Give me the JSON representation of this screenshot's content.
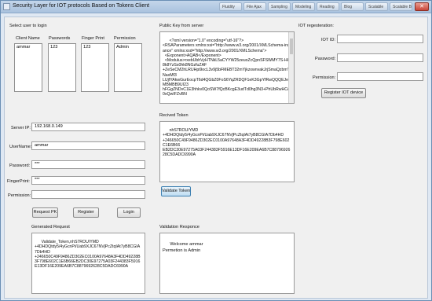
{
  "window": {
    "title": "Security Layer for IOT protocols Based on Tokens Client",
    "close_label": "✕",
    "tasks": [
      "Fluidity",
      "File Ajax",
      "Sampling",
      "Modeling",
      "Reading",
      "Blog",
      "Scalable",
      "Scalable Bg"
    ]
  },
  "select_user": {
    "heading": "Select user to login",
    "columns": [
      "Client Name",
      "Passwords",
      "Finger Print",
      "Permission"
    ],
    "values": [
      "ammar",
      "123",
      "123",
      "Admin"
    ]
  },
  "public_key": {
    "label": "Public Key from server",
    "content": "<?xml version=\"1.0\" encoding=\"utf-16\"?>\n<RSAParameters xmlns:xsi=\"http://www.w3.org/2001/XMLSchema-instance\" xmlns:xsd=\"http://www.w3.org/2001/XMLSchema\">\n  <Exponent>AQAB</Exponent>\n  <Modulus>rxebUbhVyHTNkL5aCYYW25zeuoZcQpnSFSWMY7S-Hk8k8YzSs0hk8NGzfuZAF\n+ZeSeCM2hLRUHpi9ocL3v9j5bFMEBT32mYjkzxwnvakJrjSmaQzbmYNaxMf3\nLUjfYAkwGurEocpT6d4QGbZ0FoS6YqZRDQF1eK3GpYfRwQQQEJewMBMBB9UI23\nhFGgZNDvC1E3hhkv0QoSW7fQcBKcgE3udTd0hg3N3+PhUbRwHCe0xQwIFZvBN"
  },
  "iot_register": {
    "heading": "IOT regesteration:",
    "id_label": "IOT ID:",
    "password_label": "Password:",
    "permission_label": "Permission:",
    "id_value": "",
    "password_value": "",
    "permission_value": "",
    "register_button": "Register IOT device"
  },
  "login_form": {
    "server_ip_label": "Server IP:",
    "server_ip_value": "192.168.0.149",
    "username_label": "UserName:",
    "username_value": "ammar",
    "password_label": "Password:",
    "password_value": "***",
    "fingerprint_label": "FingerPrint:",
    "fingerprint_value": "***",
    "permission_label": "Permission:",
    "permission_value": "",
    "request_pk_button": "Request PK",
    "register_button": "Register",
    "login_button": "Login"
  },
  "received_token": {
    "label": "Recived Token",
    "content": "nhS7ROU/YMD\n+4DHDQtdy5/4yGcnPi/Uab9XJC67NVjPcZtqIAt7yB8CGIA7Db4HD\n+246650C49F9486ZD302EC0100A97648A3F4DD49228B3F798E602C1E6B66\nEB2DC30E97275A03F244383F5916E13DF16E209EA6B7C8879692628C5DADC6990A",
    "validate_button": "Validate Token"
  },
  "generated_request": {
    "label": "Generated Request",
    "content": "Validate_Token,nhS7ROU/YMD\n+4DHDQtdy5/4yGcnPi/Uab9XJC67NVjPcZtqIAt7yB8CGIA7Db4HD\n+246650C49F9486ZD302EC0100A97648A3F4DD49228B3F798E602C1E6B66EB2DC30E97275A03F244383F5916E13DF16E209EA6B7C8879692628C5DADC6990A"
  },
  "validation_response": {
    "label": "Validation Responce",
    "content": "Welcome ammar\nPermetion is Admin"
  }
}
